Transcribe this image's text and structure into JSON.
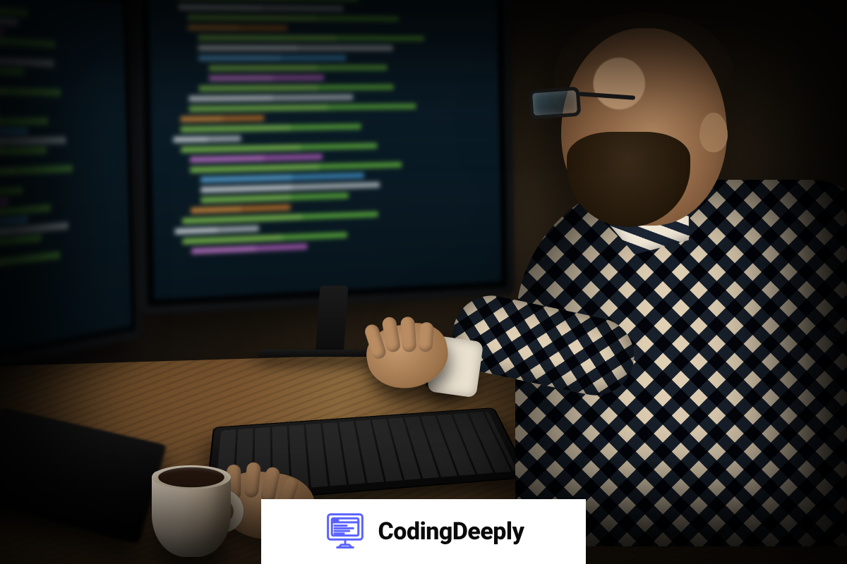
{
  "watermark": {
    "brand_name": "CodingDeeply",
    "logo_color": "#5a63ff"
  },
  "scene": {
    "description": "Bearded man with glasses and a plaid shirt coding at night on two monitors, with a keyboard, mouse, laptop and a cup of coffee on a wooden desk.",
    "objects": [
      "dual monitors with blurred source code",
      "wooden desk",
      "black keyboard",
      "black mouse",
      "coffee mug",
      "laptop (partial, bottom-left)",
      "man in checkered shirt wearing glasses"
    ]
  }
}
